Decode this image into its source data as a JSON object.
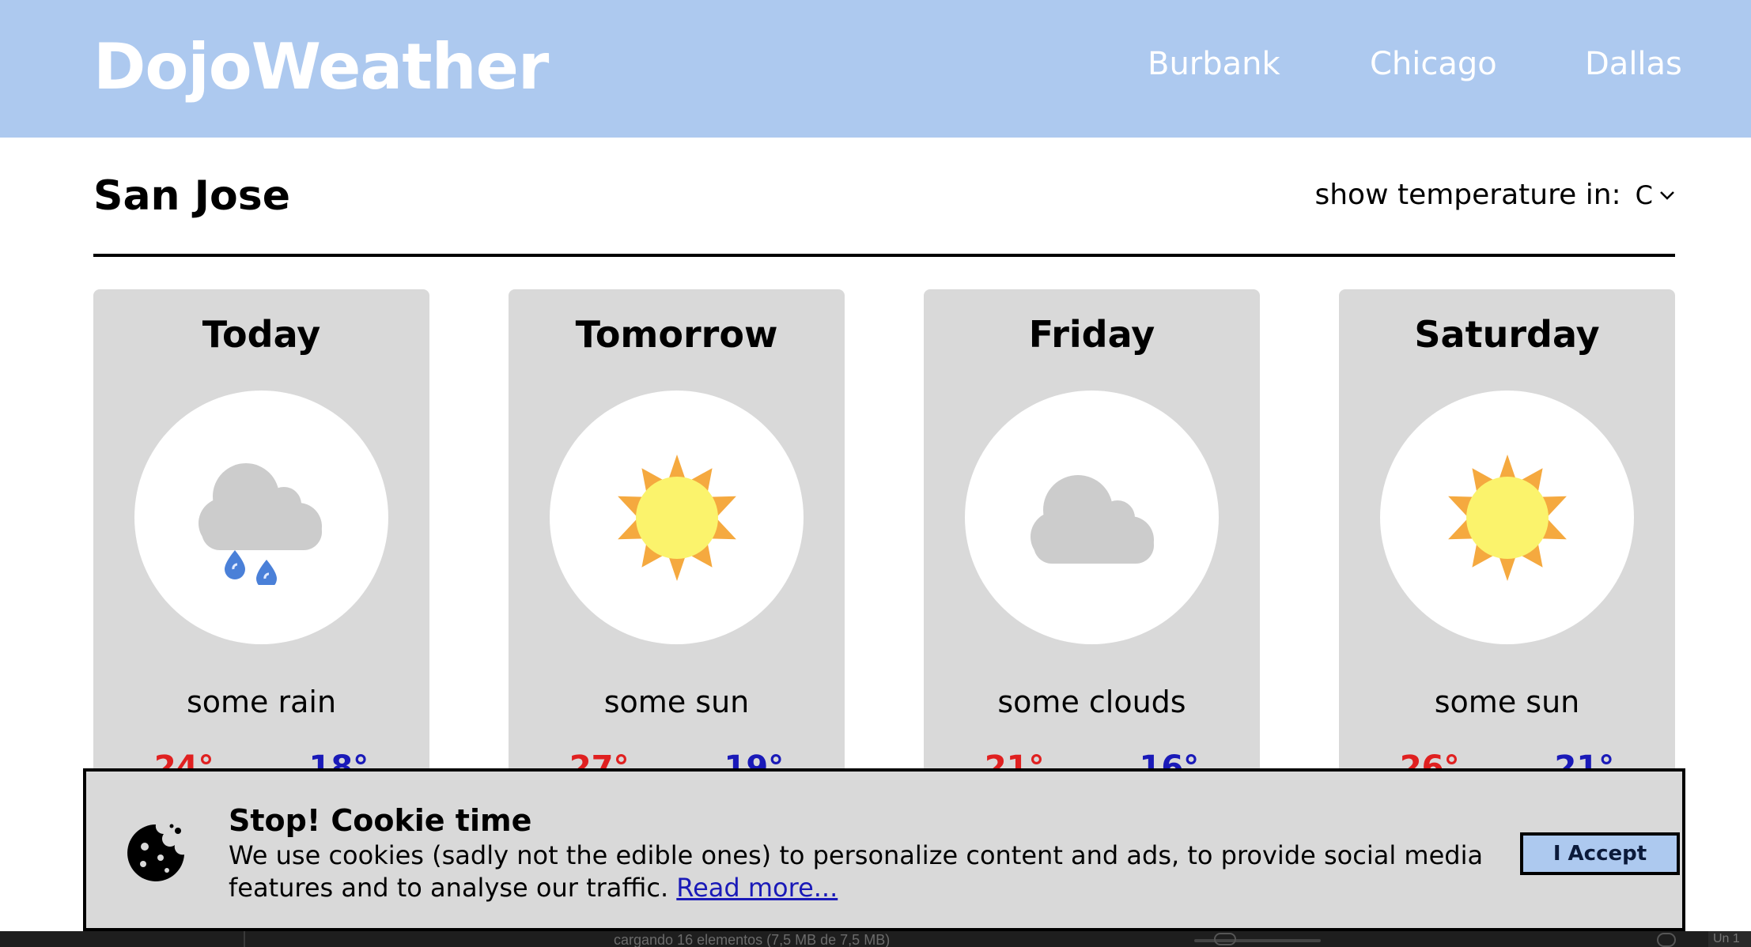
{
  "header": {
    "logo": "DojoWeather",
    "nav": [
      "Burbank",
      "Chicago",
      "Dallas"
    ]
  },
  "city": {
    "title": "San Jose",
    "temp_label": "show temperature in:",
    "temp_unit": "C"
  },
  "forecast": [
    {
      "day": "Today",
      "icon": "rain-cloud-icon",
      "desc": "some rain",
      "high": "24°",
      "low": "18°"
    },
    {
      "day": "Tomorrow",
      "icon": "sun-icon",
      "desc": "some sun",
      "high": "27°",
      "low": "19°"
    },
    {
      "day": "Friday",
      "icon": "cloud-icon",
      "desc": "some clouds",
      "high": "21°",
      "low": "16°"
    },
    {
      "day": "Saturday",
      "icon": "sun-icon",
      "desc": "some sun",
      "high": "26°",
      "low": "21°"
    }
  ],
  "cookie": {
    "title": "Stop! Cookie time",
    "text": "We use cookies (sadly not the edible ones) to personalize content and ads, to provide social media features and to analyse our traffic.",
    "link": "Read more...",
    "accept": "I Accept"
  },
  "statusbar": {
    "text": "cargando 16 elementos (7,5 MB de 7,5 MB)",
    "right": "Un 1"
  },
  "colors": {
    "header_bg": "#adc9ef",
    "card_bg": "#d9d9d9",
    "high_temp": "#e02020",
    "low_temp": "#1a1ab8",
    "sun_outer": "#f5a93f",
    "sun_inner": "#fbf36c",
    "cloud": "#cccccc",
    "rain_drop": "#4a80d8"
  }
}
